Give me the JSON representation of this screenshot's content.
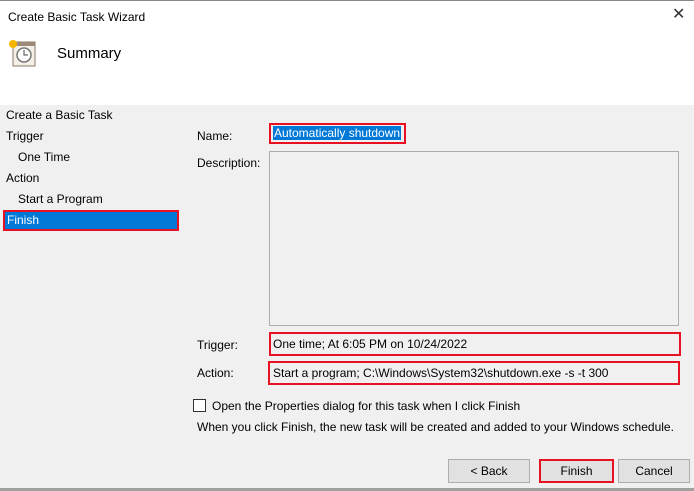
{
  "window": {
    "title": "Create Basic Task Wizard",
    "heading": "Summary"
  },
  "nav": [
    "Create a Basic Task",
    "Trigger",
    "One Time",
    "Action",
    "Start a Program",
    "Finish"
  ],
  "form": {
    "name_label": "Name:",
    "name_value": "Automatically shutdown",
    "description_label": "Description:",
    "trigger_label": "Trigger:",
    "trigger_value": "One time; At 6:05 PM on 10/24/2022",
    "action_label": "Action:",
    "action_value": "Start a program; C:\\Windows\\System32\\shutdown.exe -s -t 300"
  },
  "checkbox_label": "Open the Properties dialog for this task when I click Finish",
  "info": "When you click Finish, the new task will be created and added to your Windows schedule.",
  "buttons": {
    "back": "< Back",
    "finish": "Finish",
    "cancel": "Cancel"
  },
  "close_glyph": "✕"
}
